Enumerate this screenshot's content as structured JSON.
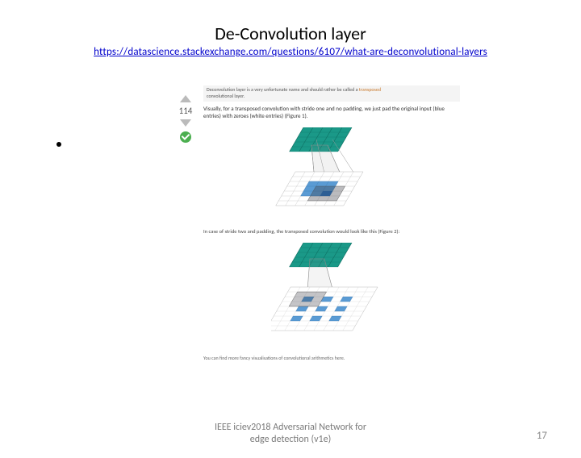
{
  "title": "De-Convolution layer",
  "link": "https://datascience.stackexchange.com/questions/6107/what-are-deconvolutional-layers",
  "vote": {
    "count": "114"
  },
  "answer": {
    "top_line_a": "Deconvolution layer is a very unfortunate name and should rather be called a ",
    "top_line_b": "transposed",
    "top_line_c": "convolutional layer.",
    "body1": "Visually, for a transposed convolution with stride one and no padding, we just pad the original input (blue entries) with zeroes (white entries) (Figure 1).",
    "caption2": "In case of stride two and padding, the transposed convolution would look like this (Figure 2):",
    "end": "You can find more fancy visualisations of convolutional arithmetics here."
  },
  "footer": {
    "line1": "IEEE iciev2018 Adversarial Network for",
    "line2": "edge detection (v1e)"
  },
  "page_number": "17"
}
